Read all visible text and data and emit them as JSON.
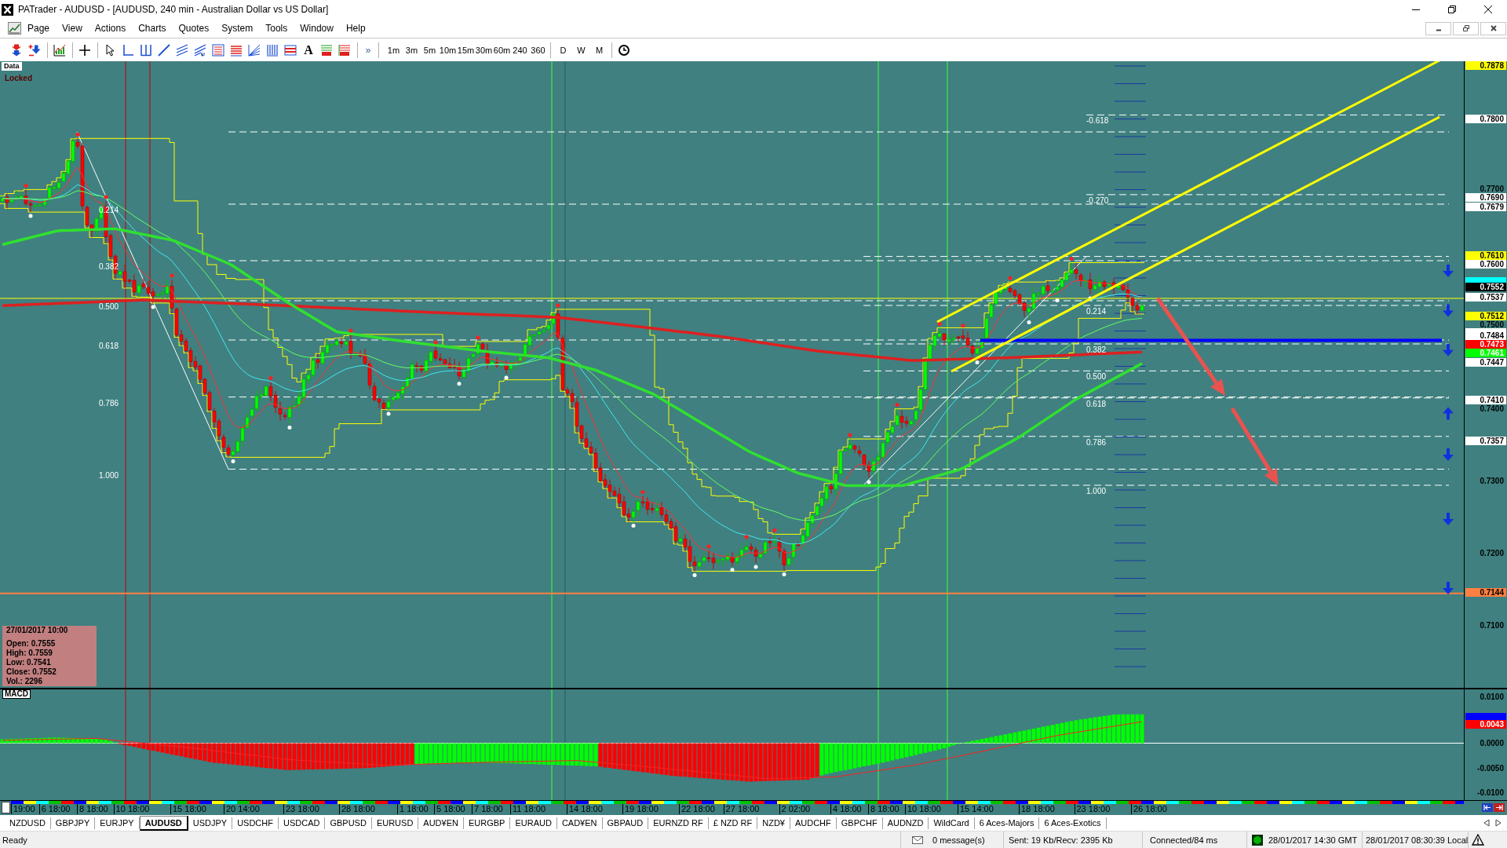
{
  "window": {
    "title": "PATrader - AUDUSD - [AUDUSD, 240 min - Australian Dollar vs US Dollar]"
  },
  "menu": {
    "items": [
      "Page",
      "View",
      "Actions",
      "Charts",
      "Quotes",
      "System",
      "Tools",
      "Window",
      "Help"
    ]
  },
  "toolbar": {
    "text_tool": "A",
    "overflow": "»",
    "timeframes": [
      "1m",
      "3m",
      "5m",
      "10m",
      "15m",
      "30m",
      "60m",
      "240",
      "360"
    ],
    "periods": [
      "D",
      "W",
      "M"
    ]
  },
  "chart": {
    "data_label": "Data",
    "lock_label": "Locked",
    "fib_left_levels": [
      "0.214",
      "0.382",
      "0.500",
      "0.618",
      "0.786",
      "1.000"
    ],
    "fib_right_levels": [
      "-0.618",
      "-0.270",
      "0.214",
      "0.382",
      "0.500",
      "0.618",
      "0.786",
      "1.000"
    ],
    "info_box": {
      "date": "27/01/2017 10:00",
      "lines": [
        "Open: 0.7555",
        "High: 0.7559",
        "Low: 0.7541",
        "Close: 0.7552",
        "Vol.: 2296"
      ]
    },
    "price_axis": [
      {
        "label": "0.7878",
        "kind": "tag",
        "color": "#ffff00"
      },
      {
        "label": "0.7800",
        "kind": "tag",
        "color": "#ffffff"
      },
      {
        "label": "0.7700",
        "kind": "tick"
      },
      {
        "label": "0.7690",
        "kind": "tag",
        "color": "#ffffff"
      },
      {
        "label": "0.7679",
        "kind": "tag",
        "color": "#ffffff"
      },
      {
        "label": "0.7610",
        "kind": "tag",
        "color": "#ffff00"
      },
      {
        "label": "0.7600",
        "kind": "tag",
        "color": "#ffffff"
      },
      {
        "kind": "marker",
        "color": "#00ffff"
      },
      {
        "label": "0.7552",
        "kind": "tag",
        "color": "#000000"
      },
      {
        "label": "0.7537",
        "kind": "tag",
        "color": "#ffffff"
      },
      {
        "label": "0.7512",
        "kind": "tag",
        "color": "#ffff00"
      },
      {
        "label": "0.7500",
        "kind": "tick"
      },
      {
        "kind": "marker",
        "color": "#ffffff"
      },
      {
        "label": "0.7484",
        "kind": "tag",
        "color": "#ffffff"
      },
      {
        "label": "0.7473",
        "kind": "tag",
        "color": "#ff0000"
      },
      {
        "label": "0.7461",
        "kind": "tag",
        "color": "#00ff00"
      },
      {
        "label": "0.7447",
        "kind": "tag",
        "color": "#ffffff"
      },
      {
        "label": "0.7410",
        "kind": "tag",
        "color": "#ffffff"
      },
      {
        "label": "0.7400",
        "kind": "tick"
      },
      {
        "label": "0.7357",
        "kind": "tag",
        "color": "#ffffff"
      },
      {
        "label": "0.7300",
        "kind": "tick"
      },
      {
        "label": "0.7200",
        "kind": "tick"
      },
      {
        "label": "0.7144",
        "kind": "tag",
        "color": "#ff8040"
      },
      {
        "label": "0.7100",
        "kind": "tick"
      }
    ]
  },
  "macd": {
    "label": "MACD",
    "axis": [
      {
        "label": "0.0100",
        "kind": "tick"
      },
      {
        "kind": "marker",
        "color": "#0000ff"
      },
      {
        "label": "0.0043",
        "kind": "tag",
        "color": "#ff0000"
      },
      {
        "label": "0.0000",
        "kind": "tick"
      },
      {
        "label": "-0.0050",
        "kind": "tick"
      },
      {
        "label": "-0.0100",
        "kind": "tick"
      }
    ]
  },
  "time_axis": [
    "19:00",
    "6 18:00",
    "8 18:00",
    "10 18:00",
    "15 18:00",
    "20 14:00",
    "23 18:00",
    "28 18:00",
    "1 18:00",
    "5 18:00",
    "7 18:00",
    "11 18:00",
    "14 18:00",
    "19 18:00",
    "22 18:00",
    "27 18:00",
    "2 02:00",
    "4 18:00",
    "8 18:00",
    "10 18:00",
    "15 14:00",
    "18 18:00",
    "23 18:00",
    "26 18:00"
  ],
  "symbol_tabs": [
    {
      "label": "NZDUSD",
      "selected": false
    },
    {
      "label": "GBPJPY",
      "selected": false
    },
    {
      "label": "EURJPY",
      "selected": false
    },
    {
      "label": "AUDUSD",
      "selected": true
    },
    {
      "label": "USDJPY",
      "selected": false
    },
    {
      "label": "USDCHF",
      "selected": false
    },
    {
      "label": "USDCAD",
      "selected": false
    },
    {
      "label": "GBPUSD",
      "selected": false
    },
    {
      "label": "EURUSD",
      "selected": false
    },
    {
      "label": "AUD¥EN",
      "selected": false
    },
    {
      "label": "EURGBP",
      "selected": false
    },
    {
      "label": "EURAUD",
      "selected": false
    },
    {
      "label": "CAD¥EN",
      "selected": false
    },
    {
      "label": "GBPAUD",
      "selected": false
    },
    {
      "label": "EURNZD RF",
      "selected": false
    },
    {
      "label": "£ NZD RF",
      "selected": false
    },
    {
      "label": "NZD¥",
      "selected": false
    },
    {
      "label": "AUDCHF",
      "selected": false
    },
    {
      "label": "GBPCHF",
      "selected": false
    },
    {
      "label": "AUDNZD",
      "selected": false
    },
    {
      "label": "WildCard",
      "selected": false
    },
    {
      "label": "6 Aces-Majors",
      "selected": false
    },
    {
      "label": "6 Aces-Exotics",
      "selected": false
    }
  ],
  "status_bar": {
    "state": "Ready",
    "messages": "0 message(s)",
    "traffic": "Sent: 19 Kb/Recv: 2395 Kb",
    "connection": "Connected/84 ms",
    "gmt_time": "28/01/2017 14:30 GMT",
    "local_time": "28/01/2017 08:30:39 Local"
  }
}
